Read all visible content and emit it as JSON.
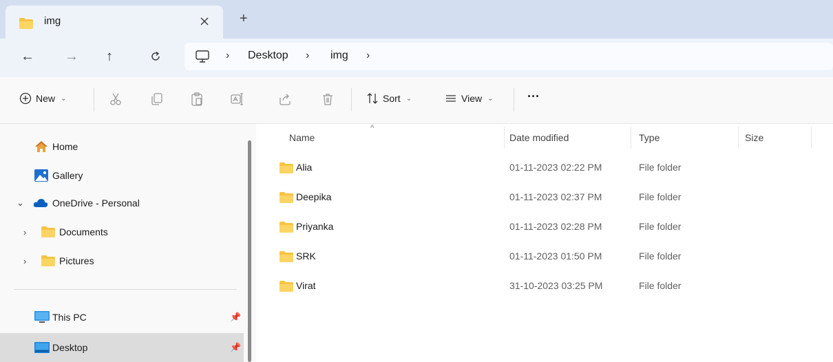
{
  "window": {
    "tab_title": "img",
    "tab_close_icon": "close-icon",
    "new_tab_label": "+"
  },
  "nav": {
    "back": "←",
    "forward": "→",
    "up": "↑",
    "refresh": "C"
  },
  "breadcrumb": {
    "sep": "›",
    "items": [
      "Desktop",
      "img"
    ]
  },
  "commands": {
    "new_label": "New",
    "sort_label": "Sort",
    "view_label": "View",
    "more_label": "···",
    "chevron": "⌄"
  },
  "sidebar": {
    "items": [
      {
        "label": "Home",
        "icon": "home-icon"
      },
      {
        "label": "Gallery",
        "icon": "gallery-icon"
      },
      {
        "label": "OneDrive - Personal",
        "icon": "cloud-icon",
        "expander": "⌄"
      },
      {
        "label": "Documents",
        "icon": "folder-icon",
        "expander": "›"
      },
      {
        "label": "Pictures",
        "icon": "folder-icon",
        "expander": "›"
      },
      {
        "label": "This PC",
        "icon": "pc-icon"
      },
      {
        "label": "Desktop",
        "icon": "desktop-icon"
      }
    ],
    "pin_icon": "pin-icon"
  },
  "columns": {
    "name": "Name",
    "date": "Date modified",
    "type": "Type",
    "size": "Size"
  },
  "files": [
    {
      "name": "Alia",
      "date": "01-11-2023 02:22 PM",
      "type": "File folder"
    },
    {
      "name": "Deepika",
      "date": "01-11-2023 02:37 PM",
      "type": "File folder"
    },
    {
      "name": "Priyanka",
      "date": "01-11-2023 02:28 PM",
      "type": "File folder"
    },
    {
      "name": "SRK",
      "date": "01-11-2023 01:50 PM",
      "type": "File folder"
    },
    {
      "name": "Virat",
      "date": "31-10-2023 03:25 PM",
      "type": "File folder"
    }
  ],
  "colors": {
    "folder": "#f6c343",
    "accent": "#0067c0",
    "selected": "#dcdcdc"
  }
}
